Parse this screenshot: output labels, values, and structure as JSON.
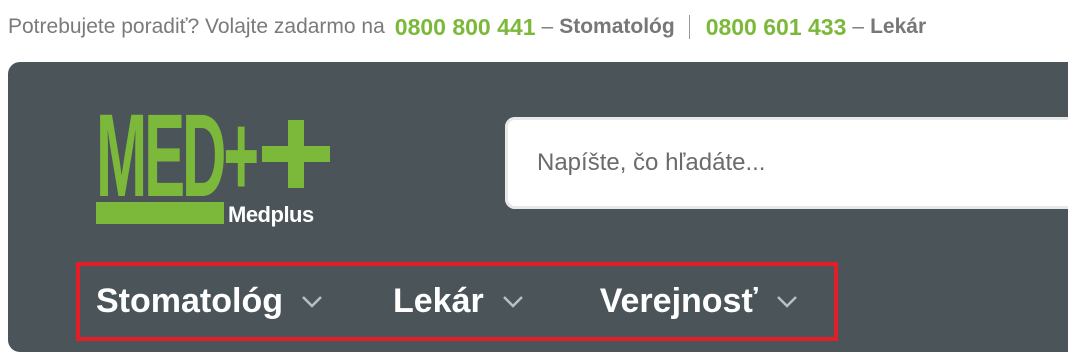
{
  "topbar": {
    "intro_text": "Potrebujete poradiť? Volajte zadarmo na",
    "dentist_phone": "0800 800 441",
    "dash1": "–",
    "dentist_label": "Stomatológ",
    "doctor_phone": "0800 601 433",
    "dash2": "–",
    "doctor_label": "Lekár"
  },
  "logo": {
    "main_text": "MED+",
    "sub_text": "Medplus",
    "color": "#7cb83a"
  },
  "search": {
    "placeholder": "Napíšte, čo hľadáte...",
    "value": ""
  },
  "nav": {
    "items": [
      {
        "label": "Stomatológ",
        "icon": "chevron-down-icon"
      },
      {
        "label": "Lekár",
        "icon": "chevron-down-icon"
      },
      {
        "label": "Verejnosť",
        "icon": "chevron-down-icon"
      }
    ],
    "highlight_color": "#e41e26"
  },
  "colors": {
    "header_bg": "#4a5459",
    "accent_green": "#7cb83a",
    "topbar_text": "#7a7a7a"
  }
}
